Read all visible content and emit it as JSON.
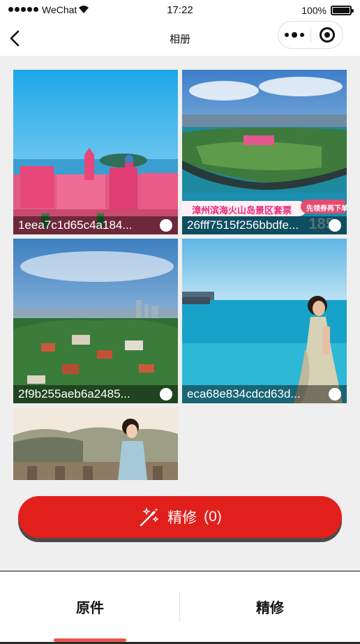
{
  "status_bar": {
    "carrier": "WeChat",
    "time": "17:22",
    "battery": "100%"
  },
  "nav": {
    "title": "相册",
    "back_icon": "chevron-left-icon",
    "more_icon": "more-dots-icon",
    "close_icon": "target-circle-icon"
  },
  "photos": [
    {
      "name": "1eea7c1d65c4a184...",
      "scene": "pink-castle-coast"
    },
    {
      "name": "26fff7515f256bbdfe...",
      "scene": "volcanic-island-aerial"
    },
    {
      "name": "2f9b255aeb6a2485...",
      "scene": "gulangyu-city-view"
    },
    {
      "name": "eca68e834cdcd63d...",
      "scene": "woman-blue-sea"
    },
    {
      "name": "",
      "scene": "woman-hanfu-bridge"
    }
  ],
  "promo": {
    "title": "漳州滨海火山岛景区套票",
    "badge": "先领券再下单",
    "price": "185"
  },
  "action": {
    "label": "精修",
    "count": "(0)",
    "icon": "magic-wand-icon",
    "color": "#e11f1b"
  },
  "tabs": {
    "original": "原件",
    "refined": "精修",
    "active_color": "#e8574a"
  }
}
